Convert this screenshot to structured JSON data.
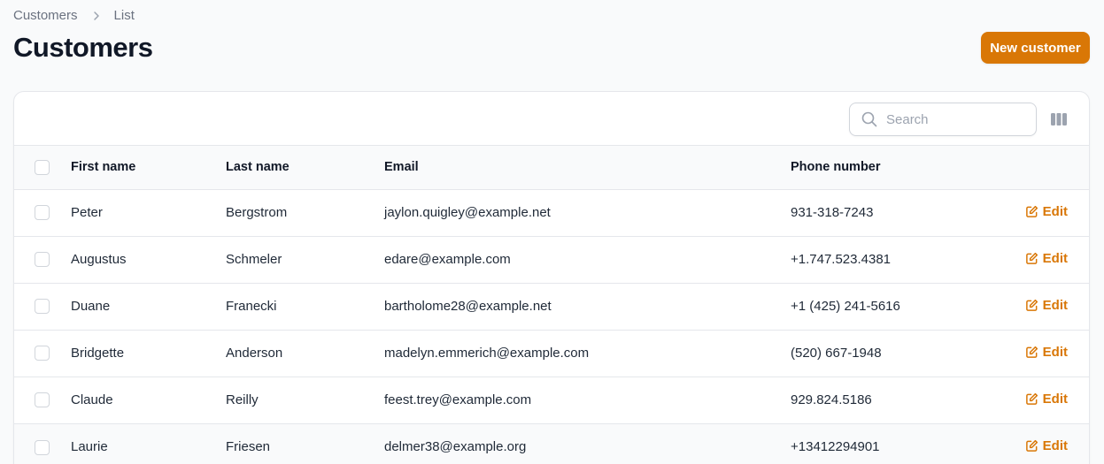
{
  "breadcrumb": {
    "items": [
      "Customers",
      "List"
    ]
  },
  "page": {
    "title": "Customers",
    "new_button": "New customer"
  },
  "search": {
    "placeholder": "Search"
  },
  "table": {
    "headers": {
      "first": "First name",
      "last": "Last name",
      "email": "Email",
      "phone": "Phone number"
    },
    "rows": [
      {
        "first": "Peter",
        "last": "Bergstrom",
        "email": "jaylon.quigley@example.net",
        "phone": "931-318-7243",
        "action": "Edit"
      },
      {
        "first": "Augustus",
        "last": "Schmeler",
        "email": "edare@example.com",
        "phone": "+1.747.523.4381",
        "action": "Edit"
      },
      {
        "first": "Duane",
        "last": "Franecki",
        "email": "bartholome28@example.net",
        "phone": "+1 (425) 241-5616",
        "action": "Edit"
      },
      {
        "first": "Bridgette",
        "last": "Anderson",
        "email": "madelyn.emmerich@example.com",
        "phone": "(520) 667-1948",
        "action": "Edit"
      },
      {
        "first": "Claude",
        "last": "Reilly",
        "email": "feest.trey@example.com",
        "phone": "929.824.5186",
        "action": "Edit"
      },
      {
        "first": "Laurie",
        "last": "Friesen",
        "email": "delmer38@example.org",
        "phone": "+13412294901",
        "action": "Edit"
      }
    ]
  },
  "colors": {
    "accent": "#d97706",
    "border": "#e5e7eb"
  },
  "icons": {
    "breadcrumb_separator": "chevron-right-icon",
    "search": "search-icon",
    "columns": "columns-icon",
    "edit": "pencil-square-icon"
  }
}
